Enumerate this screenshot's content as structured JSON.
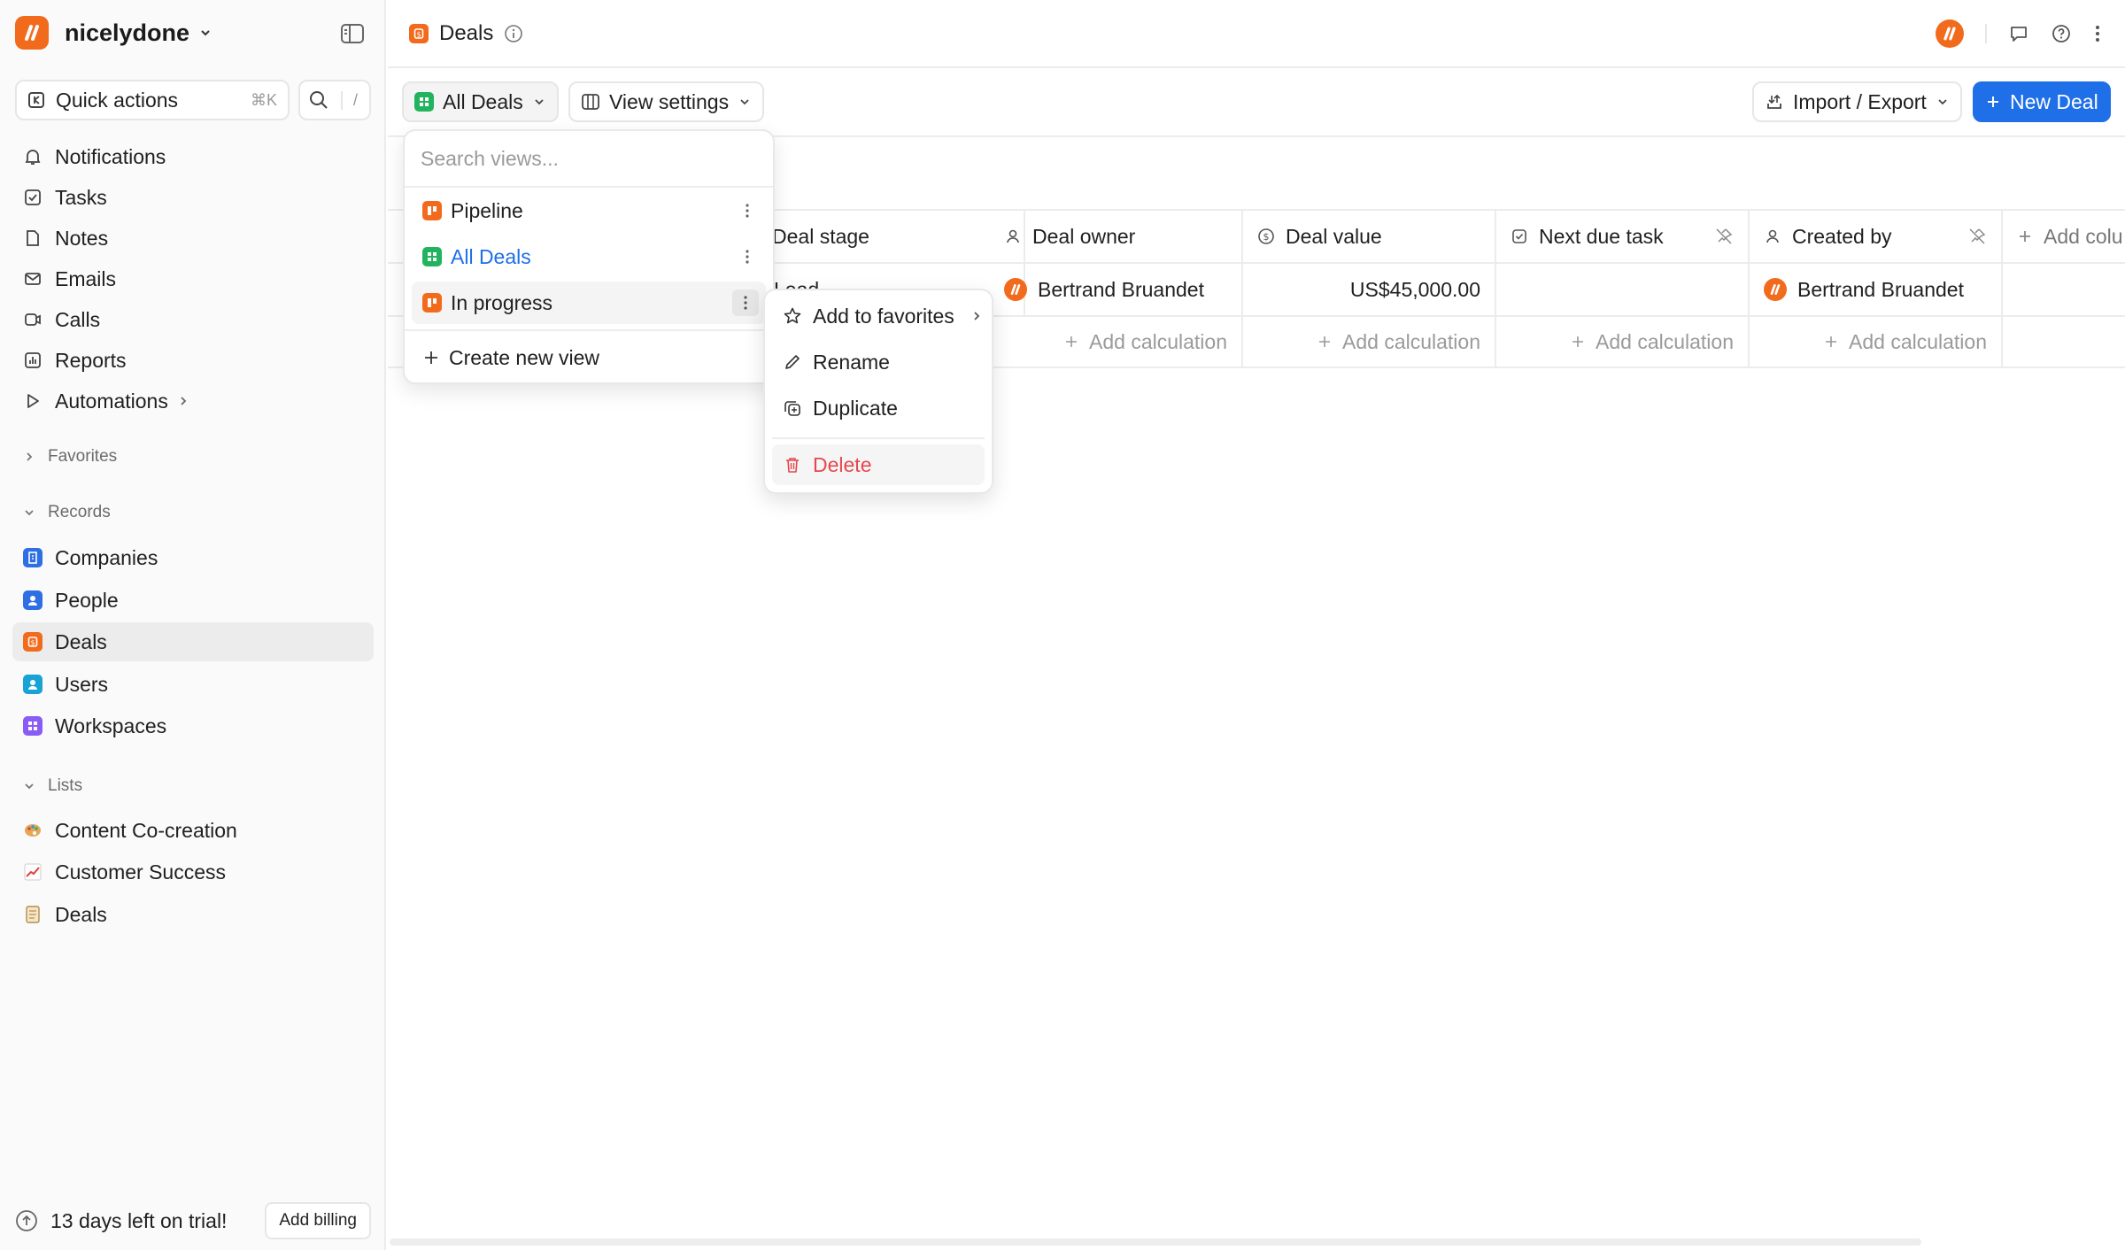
{
  "workspace": {
    "name": "nicelydone"
  },
  "sidebar": {
    "quick_actions": {
      "label": "Quick actions",
      "shortcut": "⌘K"
    },
    "search_shortcut": "/",
    "nav": [
      {
        "label": "Notifications",
        "icon": "bell-icon"
      },
      {
        "label": "Tasks",
        "icon": "checkbox-icon"
      },
      {
        "label": "Notes",
        "icon": "note-icon"
      },
      {
        "label": "Emails",
        "icon": "mail-icon"
      },
      {
        "label": "Calls",
        "icon": "video-icon"
      },
      {
        "label": "Reports",
        "icon": "chart-icon"
      },
      {
        "label": "Automations",
        "icon": "play-icon"
      }
    ],
    "favorites_label": "Favorites",
    "records_label": "Records",
    "records": [
      {
        "label": "Companies",
        "color": "#2f6fe4"
      },
      {
        "label": "People",
        "color": "#2f6fe4"
      },
      {
        "label": "Deals",
        "color": "#f26b1d"
      },
      {
        "label": "Users",
        "color": "#17a3d6"
      },
      {
        "label": "Workspaces",
        "color": "#8a5cf6"
      }
    ],
    "lists_label": "Lists",
    "lists": [
      {
        "label": "Content Co-creation",
        "icon": "palette-icon"
      },
      {
        "label": "Customer Success",
        "icon": "chart-up-icon"
      },
      {
        "label": "Deals",
        "icon": "ledger-icon"
      }
    ],
    "trial": {
      "text": "13 days left on trial!",
      "button": "Add billing"
    }
  },
  "header": {
    "title": "Deals"
  },
  "toolbar": {
    "view_label": "All Deals",
    "view_settings": "View settings",
    "import_export": "Import / Export",
    "new_deal": "New Deal"
  },
  "table": {
    "columns": [
      {
        "label": "Deal stage"
      },
      {
        "label": "Deal owner"
      },
      {
        "label": "Deal value"
      },
      {
        "label": "Next due task"
      },
      {
        "label": "Created by"
      },
      {
        "label": "Add colu"
      }
    ],
    "row": {
      "deal_stage": "Lead",
      "deal_owner": "Bertrand Bruandet",
      "deal_value": "US$45,000.00",
      "created_by": "Bertrand Bruandet"
    },
    "add_calculation": "Add calculation"
  },
  "views_menu": {
    "search_placeholder": "Search views...",
    "items": [
      {
        "label": "Pipeline",
        "color": "#f26b1d"
      },
      {
        "label": "All Deals",
        "color": "#22b35e",
        "selected_color": "#1f6fe8"
      },
      {
        "label": "In progress",
        "color": "#f26b1d"
      }
    ],
    "create_new": "Create new view"
  },
  "context_menu": {
    "add_to_favorites": "Add to favorites",
    "rename": "Rename",
    "duplicate": "Duplicate",
    "delete": "Delete"
  },
  "colors": {
    "accent": "#1f6fe8",
    "brand": "#f26b1d",
    "danger": "#e5484d"
  }
}
